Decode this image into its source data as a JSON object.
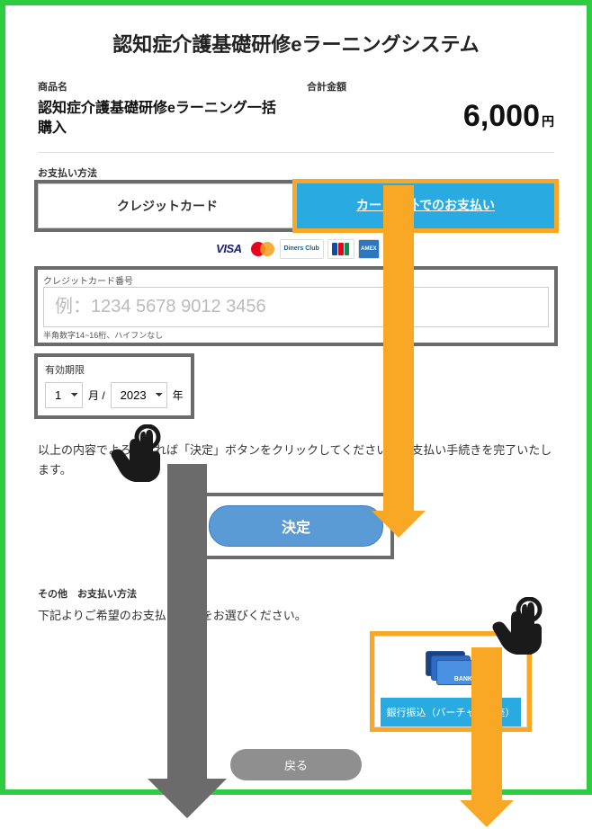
{
  "page_title": "認知症介護基礎研修eラーニングシステム",
  "product": {
    "label": "商品名",
    "name": "認知症介護基礎研修eラーニング一括購入"
  },
  "total": {
    "label": "合計金額",
    "amount": "6,000",
    "unit": "円"
  },
  "payment_method": {
    "label": "お支払い方法",
    "tab_credit": "クレジットカード",
    "tab_other": "カード以外でのお支払い"
  },
  "brands": {
    "visa": "VISA",
    "diners": "Diners Club",
    "amex": "AMEX"
  },
  "card_number": {
    "label": "クレジットカード番号",
    "placeholder": "例：1234 5678 9012 3456",
    "hint": "半角数字14~16桁、ハイフンなし"
  },
  "expiry": {
    "label": "有効期限",
    "month_value": "1",
    "month_unit": "月 /",
    "year_value": "2023",
    "year_unit": "年"
  },
  "confirm_text": "以上の内容でよろしければ「決定」ボタンをクリックしてください。お支払い手続きを完了いたします。",
  "submit_label": "決定",
  "other": {
    "heading": "その他　お支払い方法",
    "desc": "下記よりご希望のお支払い方法をお選びください。",
    "bank_badge": "BANK",
    "bank_label": "銀行振込（バーチャル口座）"
  },
  "back_label": "戻る"
}
